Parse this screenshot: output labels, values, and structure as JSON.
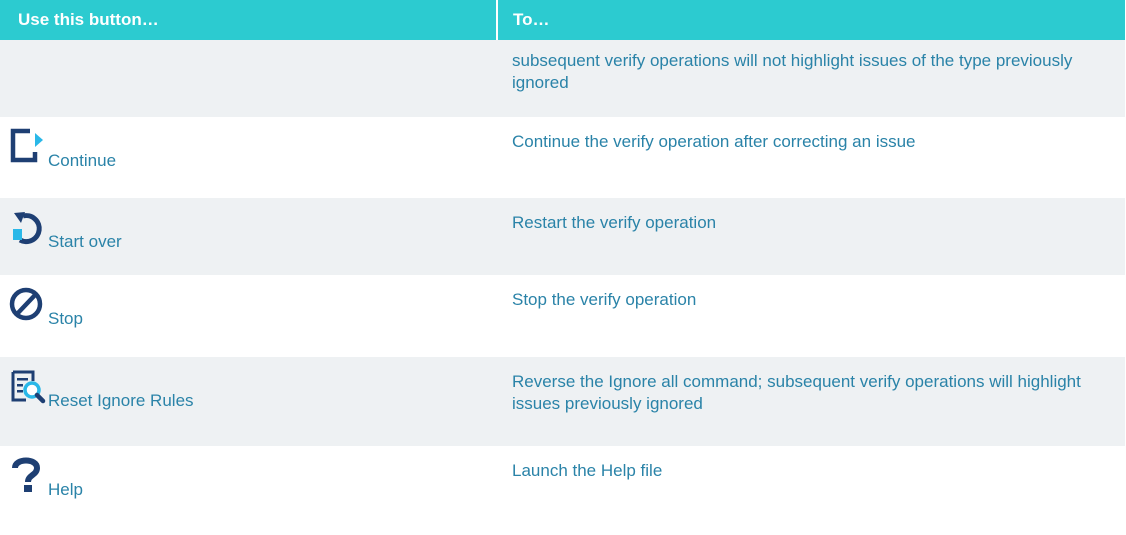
{
  "table": {
    "header": {
      "col1": "Use this button…",
      "col2": "To…"
    },
    "rows": [
      {
        "button": "",
        "icon": "",
        "description": "subsequent verify operations will not highlight issues of the type previously ignored"
      },
      {
        "button": "Continue",
        "icon": "continue-icon",
        "description": "Continue the verify operation after correcting an issue"
      },
      {
        "button": "Start over",
        "icon": "start-over-icon",
        "description": "Restart the verify operation"
      },
      {
        "button": "Stop",
        "icon": "stop-icon",
        "description": "Stop the verify operation"
      },
      {
        "button": "Reset Ignore Rules",
        "icon": "reset-ignore-rules-icon",
        "description": "Reverse the Ignore all command; subsequent verify operations will highlight issues previously ignored"
      },
      {
        "button": "Help",
        "icon": "help-icon",
        "description": "Launch the Help file"
      }
    ]
  },
  "colors": {
    "header_bg": "#2ccbd0",
    "text": "#2a83a8",
    "row_alt_bg": "#eef1f3",
    "icon_dark": "#1e3f73",
    "icon_accent": "#2ab8e8"
  }
}
